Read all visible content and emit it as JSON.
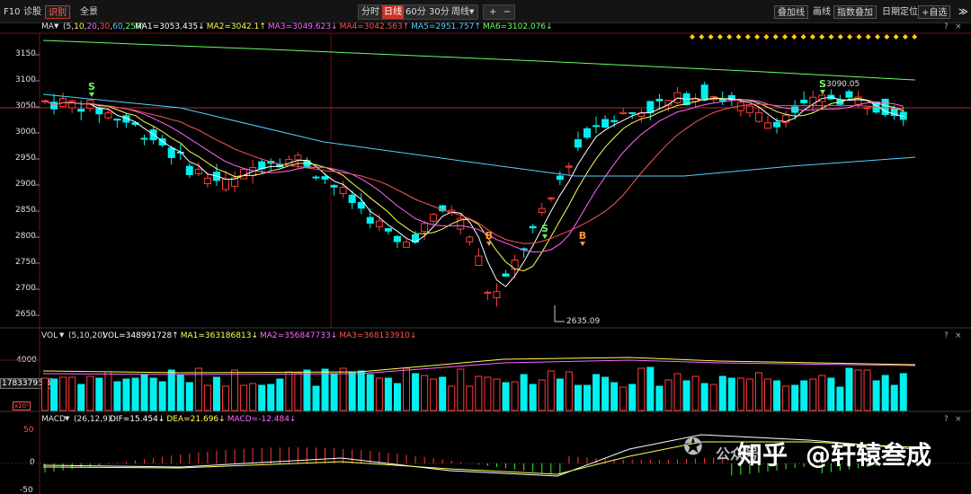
{
  "toolbar": {
    "f10": "F10",
    "diagnose": "诊股",
    "identify": "识别",
    "panorama": "全景",
    "periods": [
      "分时",
      "日线",
      "60分",
      "30分",
      "周线"
    ],
    "active_period": "日线",
    "plus": "+",
    "minus": "−",
    "overlay_line": "叠加线",
    "draw_line": "画线",
    "index_overlay": "指数叠加",
    "date_locate": "日期定位",
    "add_watch": "+自选",
    "skip": "≫"
  },
  "main_panel": {
    "indicator": "MA",
    "params_prefix": "(5,",
    "params": [
      "10",
      "20",
      "30",
      "60",
      "250"
    ],
    "ma_values": [
      {
        "label": "MA1=3053.435",
        "arrow": "↓",
        "color": "#ffffff"
      },
      {
        "label": "MA2=3042.1",
        "arrow": "↑",
        "color": "#ffff55"
      },
      {
        "label": "MA3=3049.623",
        "arrow": "↓",
        "color": "#ff66ff"
      },
      {
        "label": "MA4=3042.563",
        "arrow": "↑",
        "color": "#ff5555"
      },
      {
        "label": "MA5=2951.757",
        "arrow": "↑",
        "color": "#55d0ff"
      },
      {
        "label": "MA6=3102.076",
        "arrow": "↓",
        "color": "#66ff66"
      }
    ],
    "y_ticks": [
      "3150",
      "3100",
      "3050",
      "3000",
      "2950",
      "2900",
      "2850",
      "2800",
      "2750",
      "2700",
      "2650"
    ],
    "high_label": "3090.05",
    "low_label": "2635.09",
    "signals": [
      "S",
      "B",
      "S",
      "B",
      "S"
    ],
    "diamond_count": 25
  },
  "vol_panel": {
    "indicator": "VOL",
    "params": "(5,10,20)",
    "values": [
      {
        "label": "VOL=348991728",
        "arrow": "↑",
        "color": "#ffffff"
      },
      {
        "label": "MA1=363186813",
        "arrow": "↓",
        "color": "#ffff55"
      },
      {
        "label": "MA2=356847733",
        "arrow": "↓",
        "color": "#ff66ff"
      },
      {
        "label": "MA3=368133910",
        "arrow": "↓",
        "color": "#ff5555"
      }
    ],
    "y_tick": "4000",
    "cursor_value": "17833795.8",
    "unit": "x10⁵"
  },
  "macd_panel": {
    "indicator": "MACD",
    "params": "(26,12,9)",
    "values": [
      {
        "label": "DIF=15.454",
        "arrow": "↓",
        "color": "#ffffff"
      },
      {
        "label": "DEA=21.696",
        "arrow": "↓",
        "color": "#ffff55"
      },
      {
        "label": "MACD=-12.484",
        "arrow": "↓",
        "color": "#ff66ff"
      }
    ],
    "y_ticks": [
      "50",
      "0",
      "-50"
    ]
  },
  "panel_controls": [
    "?",
    "×"
  ],
  "watermark": {
    "source": "公众号",
    "platform": "知乎",
    "author": "@轩辕叁成"
  },
  "colors": {
    "up": "#ff3b3b",
    "down": "#00f0f0",
    "grid_red": "#6a1414",
    "bg": "#000000"
  }
}
